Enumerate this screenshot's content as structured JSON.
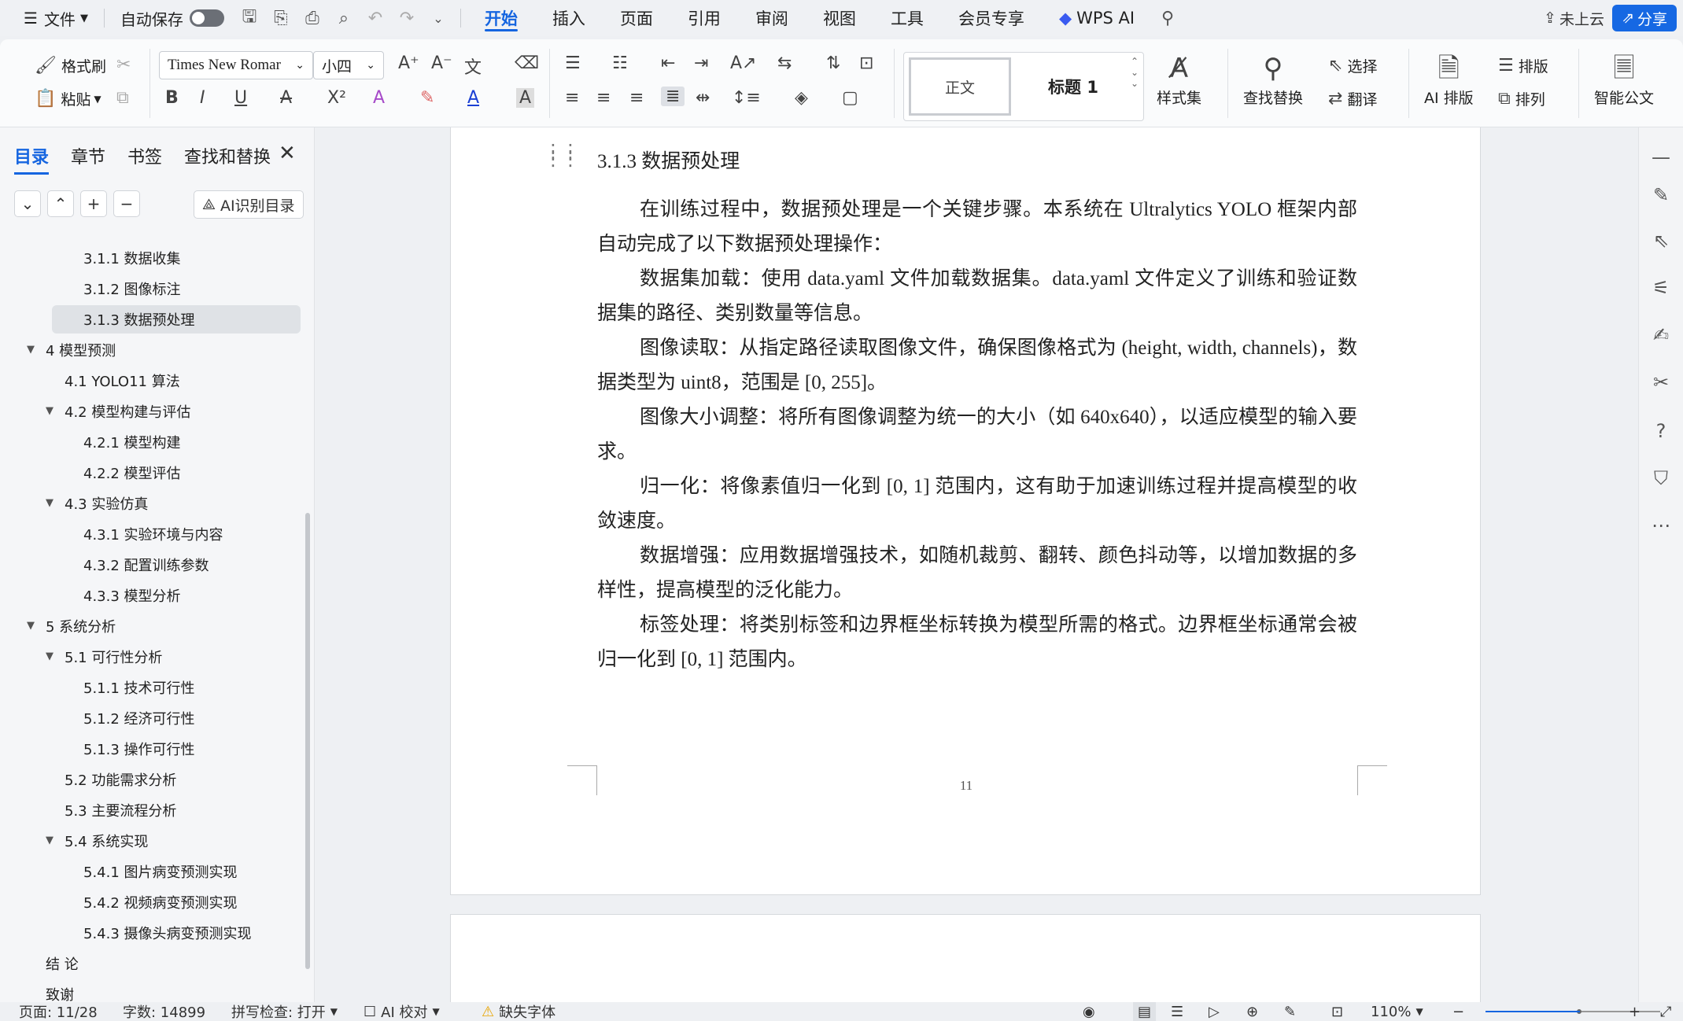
{
  "menubar": {
    "file_label": "文件",
    "autosave_label": "自动保存",
    "tabs": [
      "开始",
      "插入",
      "页面",
      "引用",
      "审阅",
      "视图",
      "工具",
      "会员专享",
      "WPS AI"
    ],
    "cloud_label": "未上云",
    "share_label": "分享"
  },
  "ribbon": {
    "format_painter": "格式刷",
    "paste": "粘贴",
    "font_name": "Times New Romar",
    "font_size": "小四",
    "style_normal": "正文",
    "style_heading1": "标题 1",
    "styles_set": "样式集",
    "find_replace": "查找替换",
    "select": "选择",
    "translate": "翻译",
    "ai_layout": "AI 排版",
    "layout": "排版",
    "arrange": "排列",
    "smart_doc": "智能公文"
  },
  "leftpanel": {
    "tabs": [
      "目录",
      "章节",
      "书签",
      "查找和替换"
    ],
    "ai_toc_label": "AI识别目录",
    "toc": [
      {
        "label": "3.1.1 数据收集",
        "level": 3
      },
      {
        "label": "3.1.2 图像标注",
        "level": 3
      },
      {
        "label": "3.1.3 数据预处理",
        "level": 3,
        "selected": true
      },
      {
        "label": "4 模型预测",
        "level": 1,
        "expanded": true
      },
      {
        "label": "4.1 YOLO11 算法",
        "level": 2
      },
      {
        "label": "4.2 模型构建与评估",
        "level": 2,
        "expanded": true
      },
      {
        "label": "4.2.1 模型构建",
        "level": 3
      },
      {
        "label": "4.2.2 模型评估",
        "level": 3
      },
      {
        "label": "4.3 实验仿真",
        "level": 2,
        "expanded": true
      },
      {
        "label": "4.3.1 实验环境与内容",
        "level": 3
      },
      {
        "label": "4.3.2 配置训练参数",
        "level": 3
      },
      {
        "label": "4.3.3 模型分析",
        "level": 3
      },
      {
        "label": "5 系统分析",
        "level": 1,
        "expanded": true
      },
      {
        "label": "5.1 可行性分析",
        "level": 2,
        "expanded": true
      },
      {
        "label": "5.1.1 技术可行性",
        "level": 3
      },
      {
        "label": "5.1.2 经济可行性",
        "level": 3
      },
      {
        "label": "5.1.3 操作可行性",
        "level": 3
      },
      {
        "label": "5.2 功能需求分析",
        "level": 2
      },
      {
        "label": "5.3 主要流程分析",
        "level": 2
      },
      {
        "label": "5.4 系统实现",
        "level": 2,
        "expanded": true
      },
      {
        "label": "5.4.1 图片病变预测实现",
        "level": 3
      },
      {
        "label": "5.4.2 视频病变预测实现",
        "level": 3
      },
      {
        "label": "5.4.3 摄像头病变预测实现",
        "level": 3
      },
      {
        "label": "结 论",
        "level": 1
      },
      {
        "label": "致谢",
        "level": 1
      }
    ]
  },
  "document": {
    "heading": "3.1.3 数据预处理",
    "paragraphs": [
      "在训练过程中，数据预处理是一个关键步骤。本系统在 Ultralytics YOLO 框架内部自动完成了以下数据预处理操作：",
      "数据集加载：使用 data.yaml 文件加载数据集。data.yaml 文件定义了训练和验证数据集的路径、类别数量等信息。",
      "图像读取：从指定路径读取图像文件，确保图像格式为 (height, width, channels)，数据类型为 uint8，范围是 [0, 255]。",
      "图像大小调整：将所有图像调整为统一的大小（如 640x640），以适应模型的输入要求。",
      "归一化：将像素值归一化到 [0, 1] 范围内，这有助于加速训练过程并提高模型的收敛速度。",
      "数据增强：应用数据增强技术，如随机裁剪、翻转、颜色抖动等，以增加数据的多样性，提高模型的泛化能力。",
      "标签处理：将类别标签和边界框坐标转换为模型所需的格式。边界框坐标通常会被归一化到 [0, 1] 范围内。"
    ],
    "page_number": "11"
  },
  "statusbar": {
    "page": "页面: 11/28",
    "word_count": "字数: 14899",
    "spell_check": "拼写检查: 打开",
    "ai_proof": "AI 校对",
    "missing_font": "缺失字体",
    "zoom": "110%"
  }
}
